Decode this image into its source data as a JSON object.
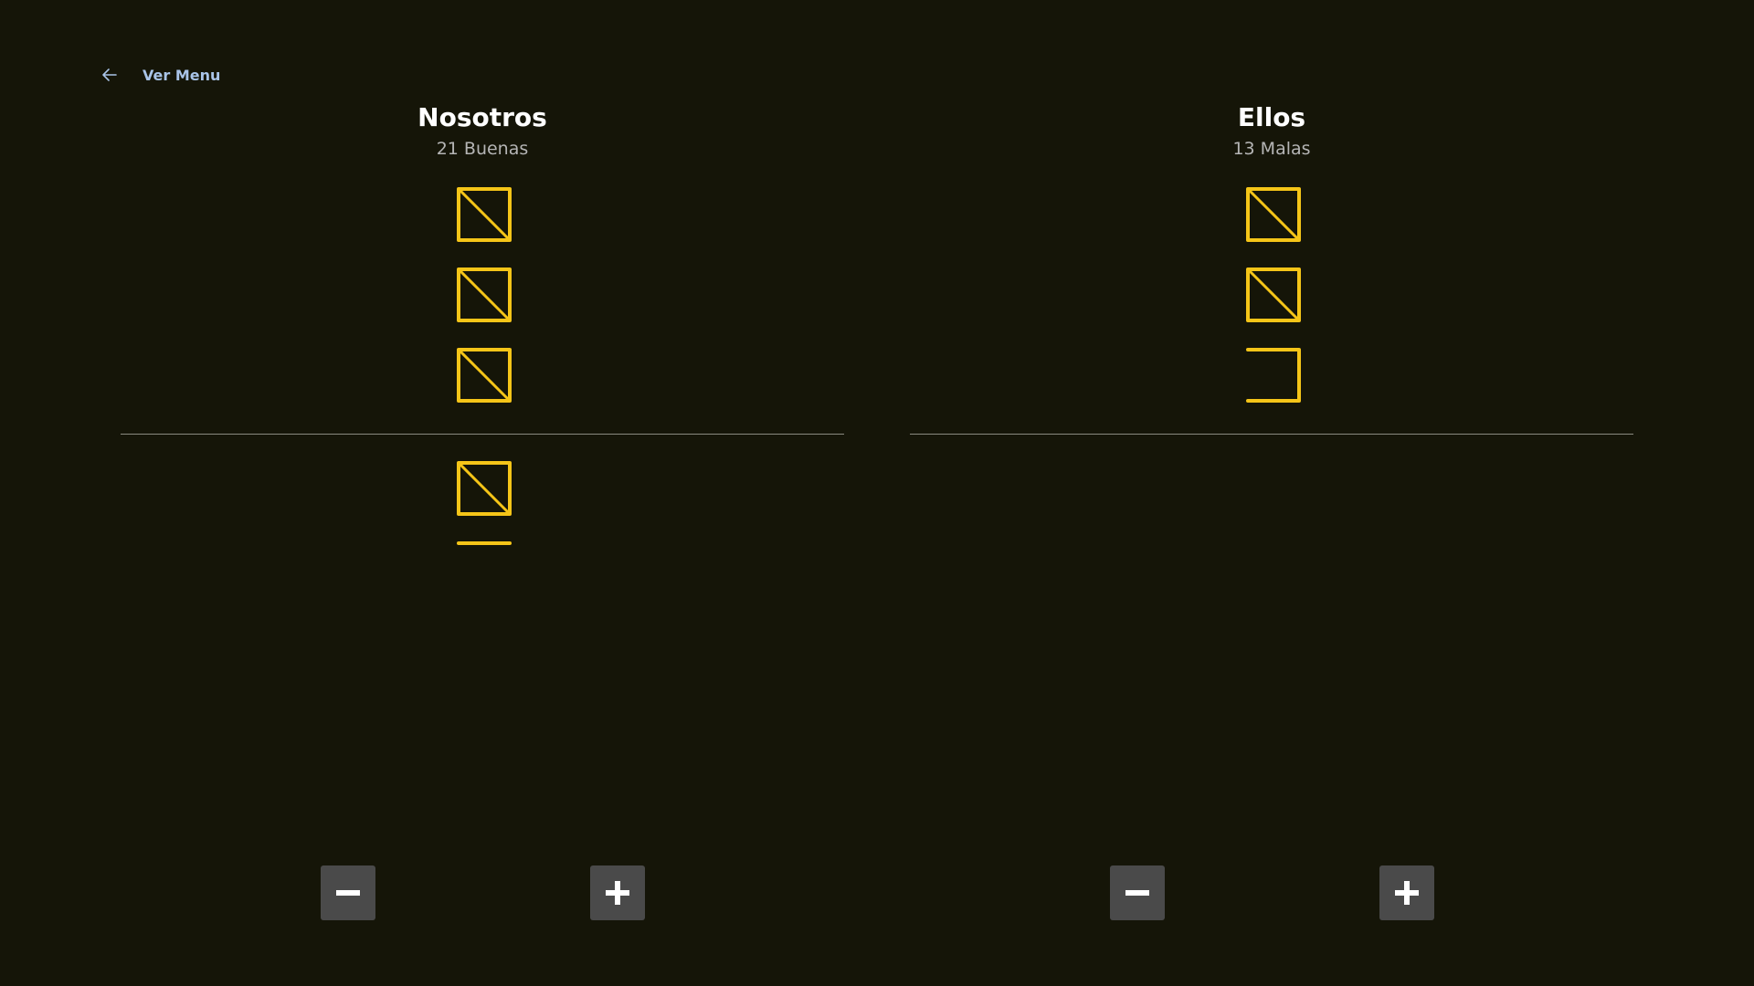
{
  "nav": {
    "back_label": "Ver Menu",
    "back_icon": "arrow-left-icon"
  },
  "teams": [
    {
      "name": "Nosotros",
      "status": "21 Buenas"
    },
    {
      "name": "Ellos",
      "status": "13 Malas"
    }
  ],
  "colors": {
    "background": "#151508",
    "tally_stroke": "#f5c518",
    "button_bg": "#4a4a4a",
    "link": "#a9c4e8"
  },
  "icons": {
    "minus": "minus-icon",
    "plus": "plus-icon"
  }
}
